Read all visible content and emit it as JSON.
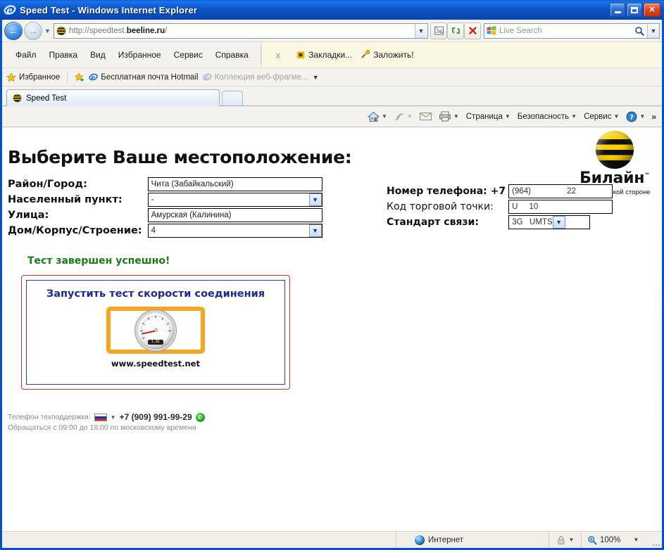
{
  "window": {
    "title": "Speed Test - Windows Internet Explorer",
    "minimize_label": "Свернуть",
    "maximize_label": "Развернуть",
    "close_label": "Закрыть"
  },
  "navigation": {
    "back_label": "Назад",
    "forward_label": "Вперед",
    "recent_pages_label": "Последние страницы",
    "address_prefix": "http://speedtest.",
    "address_domain": "beeline.ru",
    "address_suffix": "/",
    "address_full": "http://speedtest.beeline.ru/",
    "compat_label": "Режим совместимости",
    "refresh_label": "Обновить",
    "stop_label": "Остановить",
    "search_placeholder": "Live Search",
    "search_value": "",
    "search_go_label": "Поиск"
  },
  "menubar": {
    "items": [
      "Файл",
      "Правка",
      "Вид",
      "Избранное",
      "Сервис",
      "Справка"
    ],
    "close_addon_label": "x",
    "addons": [
      {
        "label": "Закладки...",
        "icon": "bookmarks-icon"
      },
      {
        "label": "Заложить!",
        "icon": "bookmark-add-icon"
      }
    ]
  },
  "favorites_bar": {
    "favorites_label": "Избранное",
    "add_label": "Добавить в избранное",
    "items": [
      {
        "label": "Бесплатная почта Hotmail",
        "dim": false
      },
      {
        "label": "Коллекция веб-фрагме...",
        "dim": true
      }
    ],
    "overflow_label": "»"
  },
  "tabs": {
    "items": [
      {
        "label": "Speed Test",
        "active": true
      }
    ],
    "new_tab_label": "Новая вкладка"
  },
  "command_bar": {
    "home_label": "Домашняя страница",
    "feeds_label": "Веб-каналы",
    "mail_label": "Почта",
    "print_label": "Печать",
    "items": [
      "Страница",
      "Безопасность",
      "Сервис"
    ],
    "help_label": "Справка",
    "overflow_label": "»"
  },
  "page": {
    "title": "Выберите Ваше местоположение:",
    "logo": {
      "word": "Билайн",
      "trademark": "™",
      "tagline": "живи на яркой стороне"
    },
    "location_form": {
      "rows": [
        {
          "label": "Район/Город:",
          "value": "Чита (Забайкальский)",
          "type": "text",
          "bold": true
        },
        {
          "label": "Населенный пункт:",
          "value": "-",
          "type": "select",
          "bold": true
        },
        {
          "label": "Улица:",
          "value": "Амурская (Калинина)",
          "type": "text",
          "bold": true
        },
        {
          "label": "Дом/Корпус/Строение:",
          "value": "4",
          "type": "select",
          "bold": true
        }
      ]
    },
    "contact_form": {
      "phone_label": "Номер телефона:",
      "phone_prefix": "+7",
      "phone_code": "(964)",
      "phone_number": "22",
      "pos_label": "Код торговой точки:",
      "pos_letter": "U",
      "pos_number": "10",
      "standard_label": "Стандарт связи:",
      "standard_value": "3G   UMTS"
    },
    "status_message": "Тест завершен успешно!",
    "speedtest": {
      "link_label": "Запустить тест скорости соединения",
      "url_label": "www.speedtest.net",
      "gauge_reading": "1.81"
    },
    "support": {
      "phone_label": "Телефон техподдержки:",
      "phone_number": "+7 (909) 991-99-29",
      "hours_text": "Обращаться с 09:00 до 18:00 по московскому времени"
    }
  },
  "status_bar": {
    "zone_label": "Интернет",
    "protected_mode_label": "Защищенный режим",
    "zoom_label": "100%"
  },
  "colors": {
    "brand_yellow": "#ffd000",
    "brand_black": "#101010",
    "success_green": "#1a7a1a",
    "box_red": "#c0392b",
    "box_blue": "#2b3f9e",
    "link_navy": "#1d2b8f",
    "gauge_orange": "#f5a623"
  }
}
